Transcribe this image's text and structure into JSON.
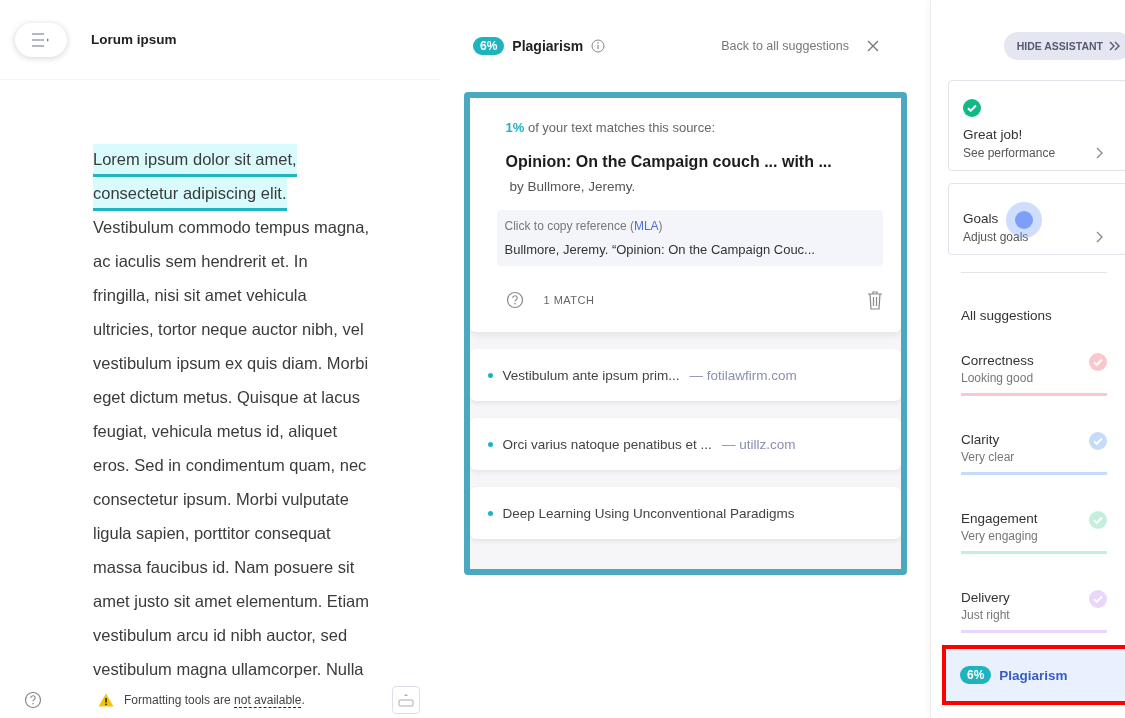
{
  "editor": {
    "title": "Lorum ipsum",
    "lines": [
      {
        "text": "Lorem ipsum dolor sit amet,",
        "highlighted": true
      },
      {
        "text": "consectetur adipiscing elit.",
        "highlighted": true
      },
      {
        "text": "Vestibulum commodo tempus magna,",
        "highlighted": false
      },
      {
        "text": "ac iaculis sem hendrerit et. In",
        "highlighted": false
      },
      {
        "text": "fringilla, nisi sit amet vehicula",
        "highlighted": false
      },
      {
        "text": "ultricies, tortor neque auctor nibh, vel",
        "highlighted": false
      },
      {
        "text": "vestibulum ipsum ex quis diam. Morbi",
        "highlighted": false
      },
      {
        "text": "eget dictum metus. Quisque at lacus",
        "highlighted": false
      },
      {
        "text": "feugiat, vehicula metus id, aliquet",
        "highlighted": false
      },
      {
        "text": "eros. Sed in condimentum quam, nec",
        "highlighted": false
      },
      {
        "text": "consectetur ipsum. Morbi vulputate",
        "highlighted": false
      },
      {
        "text": "ligula sapien, porttitor consequat",
        "highlighted": false
      },
      {
        "text": "massa faucibus id. Nam posuere sit",
        "highlighted": false
      },
      {
        "text": "amet justo sit amet elementum. Etiam",
        "highlighted": false
      },
      {
        "text": "vestibulum arcu id nibh auctor, sed",
        "highlighted": false
      },
      {
        "text": "vestibulum magna ullamcorper. Nulla",
        "highlighted": false
      }
    ],
    "notice": {
      "prefix": "Formatting tools are ",
      "link": "not available",
      "suffix": "."
    }
  },
  "plagiarism": {
    "badge": "6%",
    "title": "Plagiarism",
    "back": "Back to all suggestions",
    "source": {
      "percent": "1%",
      "match_text": " of your text matches this source:",
      "title": "Opinion: On the Campaign couch ... with ...",
      "author": "by Bullmore, Jeremy.",
      "ref_prefix": "Click to copy reference (",
      "ref_style": "MLA",
      "ref_suffix": ")",
      "citation": "Bullmore, Jeremy. “Opinion: On the Campaign Couc...",
      "matches": "1 MATCH"
    },
    "other_sources": [
      {
        "text": "Vestibulum ante ipsum prim...",
        "domain": "— fotilawfirm.com"
      },
      {
        "text": "Orci varius natoque penatibus et ...",
        "domain": "— utillz.com"
      },
      {
        "text": "Deep Learning Using Unconventional Paradigms"
      }
    ]
  },
  "assistant": {
    "hide_button": "HIDE ASSISTANT",
    "cards": [
      {
        "title": "Great job!",
        "subtitle": "See performance",
        "checked": true
      },
      {
        "title": "Goals",
        "subtitle": "Adjust goals",
        "checked": false
      }
    ],
    "section_title": "All suggestions",
    "categories": [
      {
        "kind": "score",
        "name": "Correctness",
        "status": "Looking good",
        "color": "#fbc7cf",
        "selected": false
      },
      {
        "kind": "score",
        "name": "Clarity",
        "status": "Very clear",
        "color": "#c6dbfa",
        "selected": false
      },
      {
        "kind": "score",
        "name": "Engagement",
        "status": "Very engaging",
        "color": "#c4efdf",
        "selected": false
      },
      {
        "kind": "score",
        "name": "Delivery",
        "status": "Just right",
        "color": "#e9d6fa",
        "selected": false
      },
      {
        "kind": "badge",
        "name": "Plagiarism",
        "badge": "6%",
        "color": "#1fb3c0",
        "selected": true
      }
    ]
  }
}
